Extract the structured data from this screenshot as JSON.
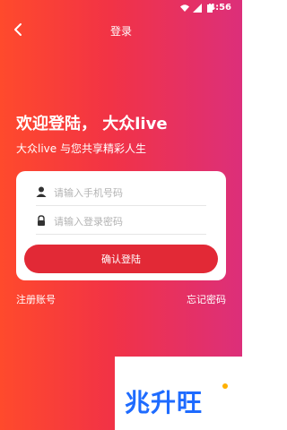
{
  "status_bar": {
    "time": "4:56"
  },
  "header": {
    "title": "登录"
  },
  "hero": {
    "headline": "欢迎登陆， 大众live",
    "subline": "大众live 与您共享精彩人生"
  },
  "form": {
    "phone_placeholder": "请输入手机号码",
    "password_placeholder": "请输入登录密码",
    "submit_label": "确认登陆"
  },
  "links": {
    "register": "注册账号",
    "forgot": "忘记密码"
  },
  "watermark": {
    "text": "兆升旺"
  },
  "colors": {
    "accent": "#e22936",
    "gradient_left": "#ff4a2c",
    "gradient_right": "#dc2f7a",
    "watermark_blue": "#1e6bff"
  }
}
